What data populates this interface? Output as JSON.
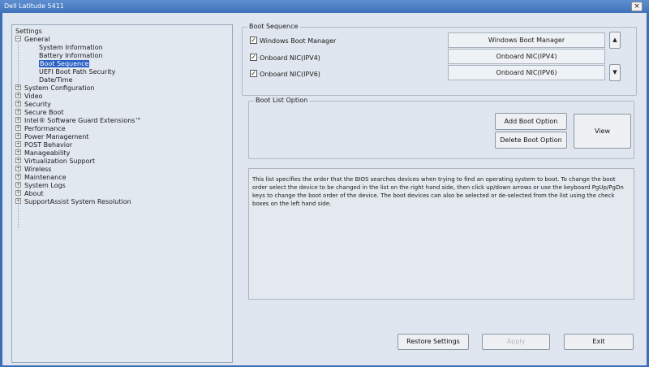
{
  "window": {
    "title": "Dell Latitude 5411",
    "close_glyph": "×"
  },
  "tree": {
    "root": "Settings",
    "items": [
      {
        "label": "General",
        "expander": "−",
        "children": [
          "System Information",
          "Battery Information",
          "Boot Sequence",
          "UEFI Boot Path Security",
          "Date/Time"
        ]
      },
      {
        "label": "System Configuration",
        "expander": "+"
      },
      {
        "label": "Video",
        "expander": "+"
      },
      {
        "label": "Security",
        "expander": "+"
      },
      {
        "label": "Secure Boot",
        "expander": "+"
      },
      {
        "label": "Intel® Software Guard Extensions™",
        "expander": "+"
      },
      {
        "label": "Performance",
        "expander": "+"
      },
      {
        "label": "Power Management",
        "expander": "+"
      },
      {
        "label": "POST Behavior",
        "expander": "+"
      },
      {
        "label": "Manageability",
        "expander": "+"
      },
      {
        "label": "Virtualization Support",
        "expander": "+"
      },
      {
        "label": "Wireless",
        "expander": "+"
      },
      {
        "label": "Maintenance",
        "expander": "+"
      },
      {
        "label": "System Logs",
        "expander": "+"
      },
      {
        "label": "About",
        "expander": "+"
      },
      {
        "label": "SupportAssist System Resolution",
        "expander": "+"
      }
    ],
    "selected": "Boot Sequence"
  },
  "boot_sequence": {
    "title": "Boot Sequence",
    "options": [
      {
        "label": "Windows Boot Manager",
        "checked": true,
        "check_glyph": "✓"
      },
      {
        "label": "Onboard NIC(IPV4)",
        "checked": true,
        "check_glyph": "✓"
      },
      {
        "label": "Onboard NIC(IPV6)",
        "checked": true,
        "check_glyph": "✓"
      }
    ],
    "order": [
      "Windows Boot Manager",
      "Onboard NIC(IPV4)",
      "Onboard NIC(IPV6)"
    ],
    "up_glyph": "▲",
    "down_glyph": "▼"
  },
  "boot_list_option": {
    "title": "Boot List Option",
    "add_label": "Add Boot Option",
    "delete_label": "Delete Boot Option",
    "view_label": "View"
  },
  "description": "This list specifies the order that the BIOS searches devices when trying to find an operating system to boot. To change the boot order select the device to be changed in the list on the right hand side, then click up/down arrows or use the keyboard PgUp/PgDn keys to change the boot order of the device. The boot devices can also be selected or de-selected from the list using the check boxes on the left hand side.",
  "footer": {
    "restore_label": "Restore Settings",
    "apply_label": "Apply",
    "exit_label": "Exit"
  }
}
